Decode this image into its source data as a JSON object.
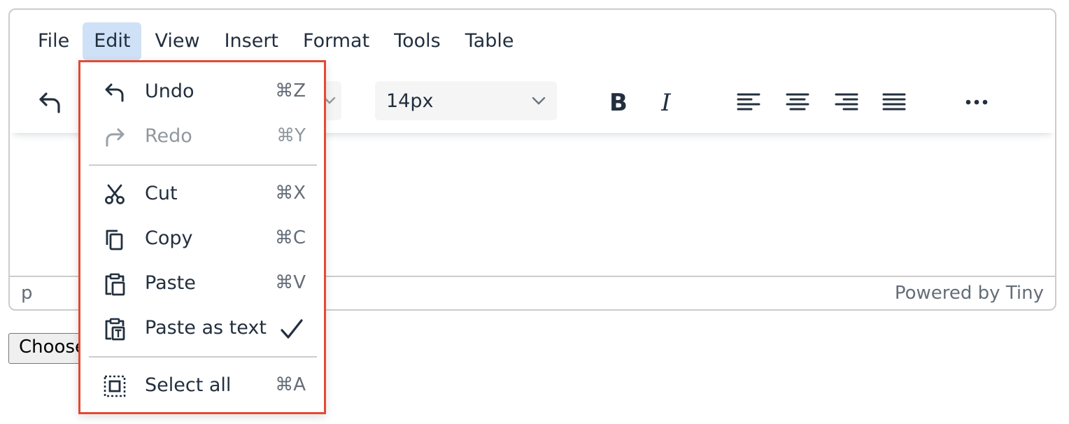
{
  "menubar": {
    "items": [
      {
        "label": "File"
      },
      {
        "label": "Edit"
      },
      {
        "label": "View"
      },
      {
        "label": "Insert"
      },
      {
        "label": "Format"
      },
      {
        "label": "Tools"
      },
      {
        "label": "Table"
      }
    ],
    "active": "Edit"
  },
  "toolbar": {
    "font_size": "14px",
    "icons": [
      "undo-icon",
      "bold-icon",
      "italic-icon",
      "align-left-icon",
      "align-center-icon",
      "align-right-icon",
      "align-justify-icon",
      "more-icon"
    ]
  },
  "edit_menu": {
    "undo": {
      "label": "Undo",
      "shortcut": "⌘Z"
    },
    "redo": {
      "label": "Redo",
      "shortcut": "⌘Y",
      "disabled": true
    },
    "cut": {
      "label": "Cut",
      "shortcut": "⌘X"
    },
    "copy": {
      "label": "Copy",
      "shortcut": "⌘C"
    },
    "paste": {
      "label": "Paste",
      "shortcut": "⌘V"
    },
    "paste_as_text": {
      "label": "Paste as text",
      "checked": true
    },
    "select_all": {
      "label": "Select all",
      "shortcut": "⌘A"
    }
  },
  "statusbar": {
    "path": "p",
    "brand": "Powered by Tiny"
  },
  "file_input": {
    "button_label": "Choose File"
  },
  "colors": {
    "text": "#222f3e",
    "active_menu_bg": "#cfe1f6",
    "highlight_border": "#e34a33"
  }
}
